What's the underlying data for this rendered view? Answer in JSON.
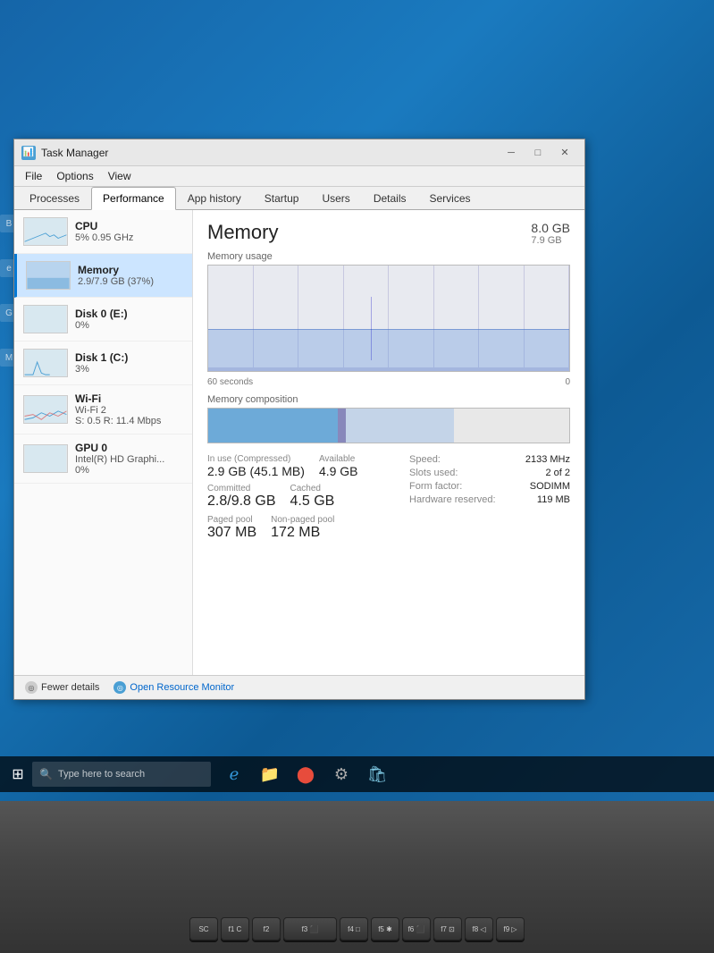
{
  "desktop": {
    "background": "#1a6a9a"
  },
  "window": {
    "title": "Task Manager",
    "icon": "📊"
  },
  "menubar": {
    "items": [
      "File",
      "Options",
      "View"
    ]
  },
  "tabs": {
    "items": [
      "Processes",
      "Performance",
      "App history",
      "Startup",
      "Users",
      "Details",
      "Services"
    ],
    "active": "Performance"
  },
  "sidebar": {
    "items": [
      {
        "name": "CPU",
        "detail": "5% 0.95 GHz",
        "selected": false,
        "type": "cpu"
      },
      {
        "name": "Memory",
        "detail": "2.9/7.9 GB (37%)",
        "selected": true,
        "type": "memory"
      },
      {
        "name": "Disk 0 (E:)",
        "detail": "0%",
        "selected": false,
        "type": "disk"
      },
      {
        "name": "Disk 1 (C:)",
        "detail": "3%",
        "selected": false,
        "type": "disk"
      },
      {
        "name": "Wi-Fi",
        "detail_line1": "Wi-Fi 2",
        "detail_line2": "S: 0.5 R: 11.4 Mbps",
        "selected": false,
        "type": "wifi"
      },
      {
        "name": "GPU 0",
        "detail_line1": "Intel(R) HD Graphi...",
        "detail_line2": "0%",
        "selected": false,
        "type": "gpu"
      }
    ]
  },
  "main": {
    "title": "Memory",
    "total": "8.0 GB",
    "total_sub": "7.9 GB",
    "chart_label": "Memory usage",
    "chart_bottom_left": "60 seconds",
    "chart_bottom_right": "0",
    "composition_label": "Memory composition",
    "stats": {
      "in_use_label": "In use (Compressed)",
      "in_use_value": "2.9 GB (45.1 MB)",
      "available_label": "Available",
      "available_value": "4.9 GB",
      "committed_label": "Committed",
      "committed_value": "2.8/9.8 GB",
      "cached_label": "Cached",
      "cached_value": "4.5 GB",
      "paged_pool_label": "Paged pool",
      "paged_pool_value": "307 MB",
      "non_paged_pool_label": "Non-paged pool",
      "non_paged_pool_value": "172 MB",
      "speed_label": "Speed:",
      "speed_value": "2133 MHz",
      "slots_label": "Slots used:",
      "slots_value": "2 of 2",
      "form_label": "Form factor:",
      "form_value": "SODIMM",
      "hw_reserved_label": "Hardware reserved:",
      "hw_reserved_value": "119 MB"
    }
  },
  "bottom": {
    "fewer_details": "Fewer details",
    "open_resource_monitor": "Open Resource Monitor"
  },
  "taskbar": {
    "search_placeholder": "Type here to search"
  },
  "keyboard": {
    "rows": [
      [
        "SC",
        "f1",
        "f2",
        "f3",
        "f4",
        "f5",
        "f6",
        "f7",
        "f8",
        "f9"
      ],
      [
        "",
        "",
        "",
        "",
        "",
        "",
        "",
        "",
        "",
        ""
      ]
    ]
  }
}
